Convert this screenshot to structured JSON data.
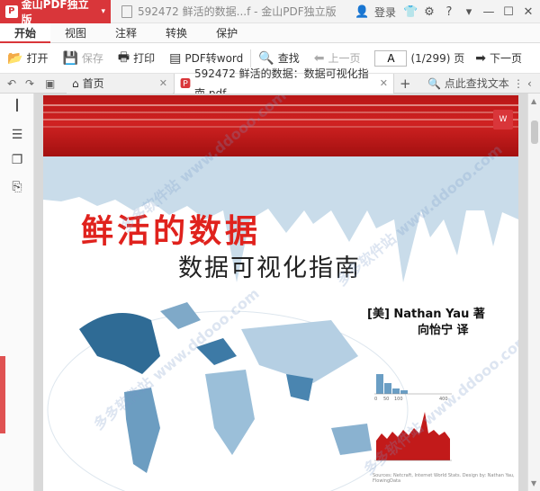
{
  "title_bar": {
    "app_name": "金山PDF独立版",
    "window_title": "592472 鲜活的数据...f - 金山PDF独立版",
    "login_label": "登录"
  },
  "menu": {
    "tabs": [
      "开始",
      "视图",
      "注释",
      "转换",
      "保护"
    ],
    "active": "开始"
  },
  "toolbar": {
    "open_label": "打开",
    "save_label": "保存",
    "print_label": "打印",
    "pdf_to_word_label": "PDF转word",
    "find_label": "查找",
    "prev_page_label": "上一页",
    "page_value": "A",
    "page_count": "(1/299) 页",
    "next_page_label": "下一页"
  },
  "tabs": {
    "home_label": "首页",
    "doc_label": "592472 鲜活的数据：数据可视化指南.pdf",
    "search_label": "点此查找文本"
  },
  "cover": {
    "title": "鲜活的数据",
    "subtitle": "数据可视化指南",
    "author": "[美] Nathan Yau 著",
    "translator": "向怡宁 译",
    "mini_axis": [
      "0",
      "50",
      "100",
      "400"
    ],
    "credit": "Sources: Netcraft, Internet World Stats. Design by: Nathan Yau, FlowingData"
  },
  "watermark": "多多软件站 www.ddooo.com",
  "colors": {
    "accent": "#d9363a",
    "cover_red": "#c21a1a",
    "map_blue": "#2f6b95"
  }
}
